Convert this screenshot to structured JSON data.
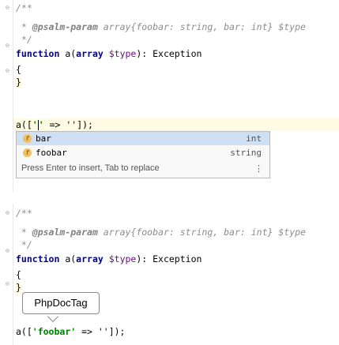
{
  "top": {
    "doc_open": "/**",
    "doc_line_star": " * ",
    "doc_tag": "@psalm-param",
    "doc_rest": " array{foobar: string, bar: int} $type",
    "doc_close": " */",
    "func_kw": "function",
    "func_name": " a(",
    "param_type": "array",
    "param_var": " $type",
    "func_ret": "): Exception",
    "brace_open": "{",
    "brace_close": "}",
    "call_prefix": "a([",
    "call_quote": "'",
    "call_suffix": " => '']);"
  },
  "completion": {
    "items": [
      {
        "icon": "f",
        "name": "bar",
        "type": "int"
      },
      {
        "icon": "f",
        "name": "foobar",
        "type": "string"
      }
    ],
    "hint": "Press Enter to insert, Tab to replace",
    "more": "⋮"
  },
  "bottom": {
    "doc_open": "/**",
    "doc_line_star": " * ",
    "doc_tag": "@psalm-param",
    "doc_rest": " array{foobar: string, bar: int} $type",
    "doc_close": " */",
    "func_kw": "function",
    "func_name": " a(",
    "param_type": "array",
    "param_var": " $type",
    "func_ret": "): Exception",
    "brace_open": "{",
    "brace_close": "}",
    "call_prefix": "a([",
    "call_str": "'foobar'",
    "call_suffix": " => '']);"
  },
  "tooltip": {
    "label": "PhpDocTag"
  }
}
